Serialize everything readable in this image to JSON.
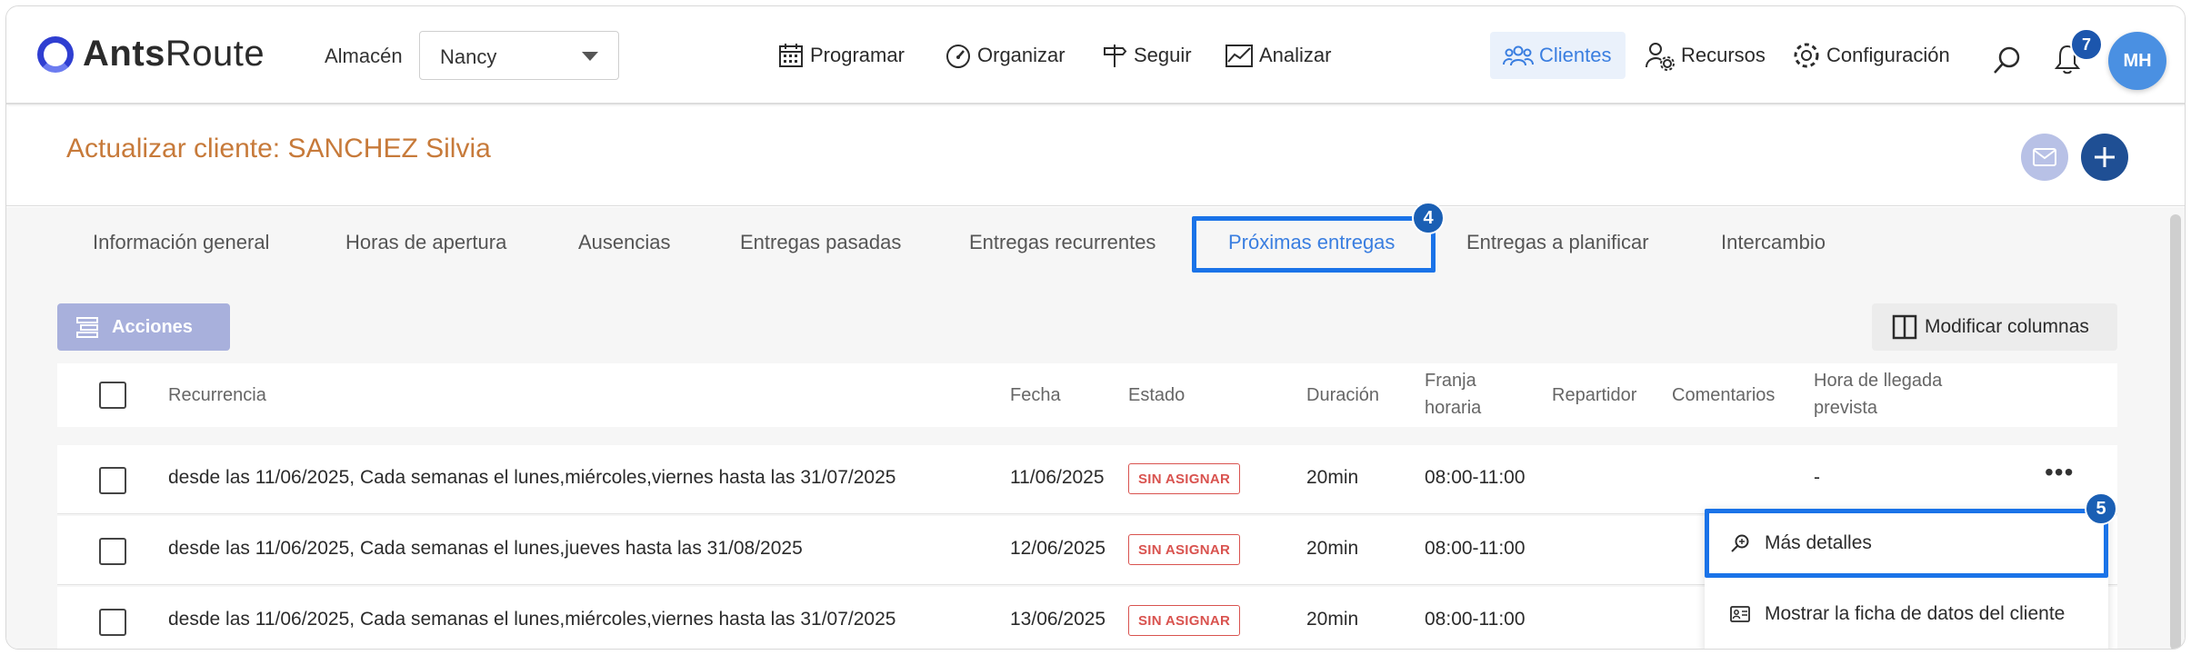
{
  "app": {
    "logo_bold": "Ants",
    "logo_light": "Route"
  },
  "warehouse": {
    "label": "Almacén",
    "value": "Nancy"
  },
  "nav": {
    "programar": "Programar",
    "organizar": "Organizar",
    "seguir": "Seguir",
    "analizar": "Analizar",
    "clientes": "Clientes",
    "recursos": "Recursos",
    "configuracion": "Configuración"
  },
  "notifications": {
    "count": "7"
  },
  "user": {
    "initials": "MH"
  },
  "page": {
    "title": "Actualizar cliente: SANCHEZ Silvia"
  },
  "tabs": [
    {
      "label": "Información general"
    },
    {
      "label": "Horas de apertura"
    },
    {
      "label": "Ausencias"
    },
    {
      "label": "Entregas pasadas"
    },
    {
      "label": "Entregas recurrentes"
    },
    {
      "label": "Próximas entregas"
    },
    {
      "label": "Entregas a planificar"
    },
    {
      "label": "Intercambio"
    }
  ],
  "step_badges": {
    "tab": "4",
    "menu": "5"
  },
  "toolbar": {
    "actions": "Acciones",
    "modify_columns": "Modificar columnas"
  },
  "table": {
    "headers": {
      "recurrence": "Recurrencia",
      "date": "Fecha",
      "status": "Estado",
      "duration": "Duración",
      "slot_1": "Franja",
      "slot_2": "horaria",
      "driver": "Repartidor",
      "comments": "Comentarios",
      "eta_1": "Hora de llegada",
      "eta_2": "prevista"
    },
    "rows": [
      {
        "recurrence": "desde las 11/06/2025, Cada semanas el lunes,miércoles,viernes hasta las 31/07/2025",
        "date": "11/06/2025",
        "status": "SIN ASIGNAR",
        "duration": "20min",
        "slot": "08:00-11:00",
        "eta": "-"
      },
      {
        "recurrence": "desde las 11/06/2025, Cada semanas el lunes,jueves hasta las 31/08/2025",
        "date": "12/06/2025",
        "status": "SIN ASIGNAR",
        "duration": "20min",
        "slot": "08:00-11:00"
      },
      {
        "recurrence": "desde las 11/06/2025, Cada semanas el lunes,miércoles,viernes hasta las 31/07/2025",
        "date": "13/06/2025",
        "status": "SIN ASIGNAR",
        "duration": "20min",
        "slot": "08:00-11:00"
      }
    ]
  },
  "context_menu": {
    "more_details": "Más detalles",
    "show_client_sheet": "Mostrar la ficha de datos del cliente"
  },
  "colors": {
    "accent": "#1a73e8",
    "title": "#c77a3a",
    "status": "#d9534f"
  }
}
